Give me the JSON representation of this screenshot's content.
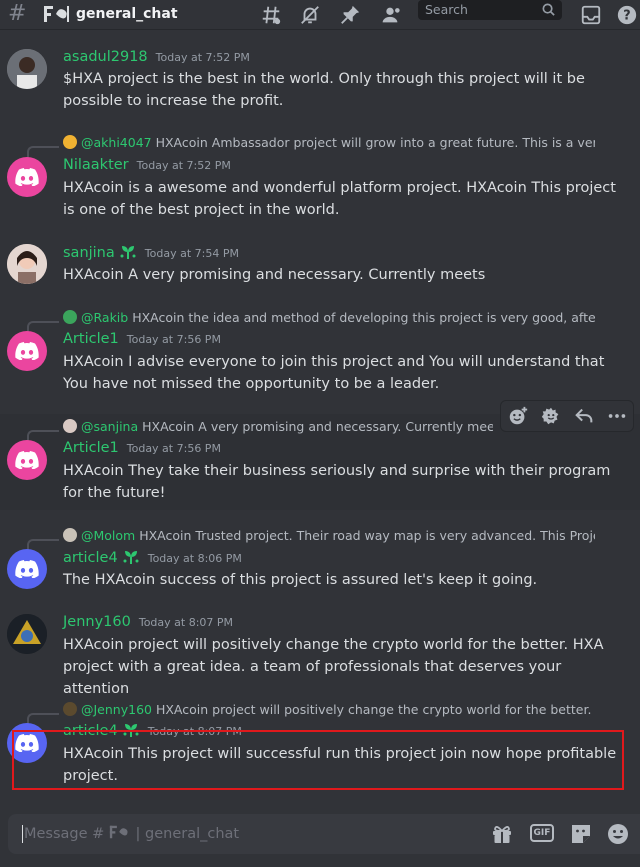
{
  "header": {
    "channel_name": "general_chat",
    "search_placeholder": "Search"
  },
  "messages": [
    {
      "username": "asadul2918",
      "timestamp": "Today at 7:52 PM",
      "text": "$HXA project is the best in the world. Only through this project will it be possible to increase the profit."
    },
    {
      "reply_mention": "@akhi4047",
      "reply_text": "HXAcoin Ambassador project will grow into a great future. This is a very un",
      "username": "Nilaakter",
      "timestamp": "Today at 7:52 PM",
      "text": "HXAcoin is a awesome and wonderful platform project. HXAcoin This project is one of the best project in the world."
    },
    {
      "username": "sanjina",
      "timestamp": "Today at 7:54 PM",
      "text": "HXAcoin A very promising and necessary. Currently meets"
    },
    {
      "reply_mention": "@Rakib",
      "reply_text": "HXAcoin the idea and method of developing this project is very good, after I ch",
      "username": "Article1",
      "timestamp": "Today at 7:56 PM",
      "text": "HXAcoin I advise everyone to join this project and You will understand that You have not missed the opportunity to be a leader."
    },
    {
      "reply_mention": "@sanjina",
      "reply_text": "HXAcoin A very promising and necessary. Currently meets",
      "username": "Article1",
      "timestamp": "Today at 7:56 PM",
      "text": "HXAcoin They take their business seriously and surprise with their program for the future!"
    },
    {
      "reply_mention": "@Molom",
      "reply_text": "HXAcoin Trusted project. Their road way map is very advanced. This Project w",
      "username": "article4",
      "timestamp": "Today at 8:06 PM",
      "text": "The HXAcoin success of this project is assured let's keep it going."
    },
    {
      "username": "Jenny160",
      "timestamp": "Today at 8:07 PM",
      "text": "HXAcoin project will positively change the crypto world for the better. HXA project with a great idea. a team of professionals that deserves your attention"
    },
    {
      "reply_mention": "@Jenny160",
      "reply_text": "HXAcoin project will positively change the crypto world for the better. HXA",
      "username": "article4",
      "timestamp": "Today at 8:07 PM",
      "text": "HXAcoin This project will successful run this project join now hope profitable project."
    }
  ],
  "composer": {
    "placeholder": "Message # ",
    "placeholder_channel": " | general_chat",
    "gif_label": "GIF"
  },
  "colors": {
    "background": "#313338",
    "username_green": "#2dc770",
    "discord_pink": "#eb459f",
    "discord_blue": "#5865f2",
    "highlight_red": "#e0191c"
  },
  "icons": [
    "hash-icon",
    "threads-icon",
    "mute-icon",
    "pin-icon",
    "members-icon",
    "search-icon",
    "inbox-icon",
    "help-icon",
    "add-reaction-icon",
    "super-reaction-icon",
    "reply-icon",
    "more-icon",
    "gift-icon",
    "sticker-icon",
    "emoji-icon",
    "discord-logo-icon",
    "sprout-badge-icon"
  ]
}
